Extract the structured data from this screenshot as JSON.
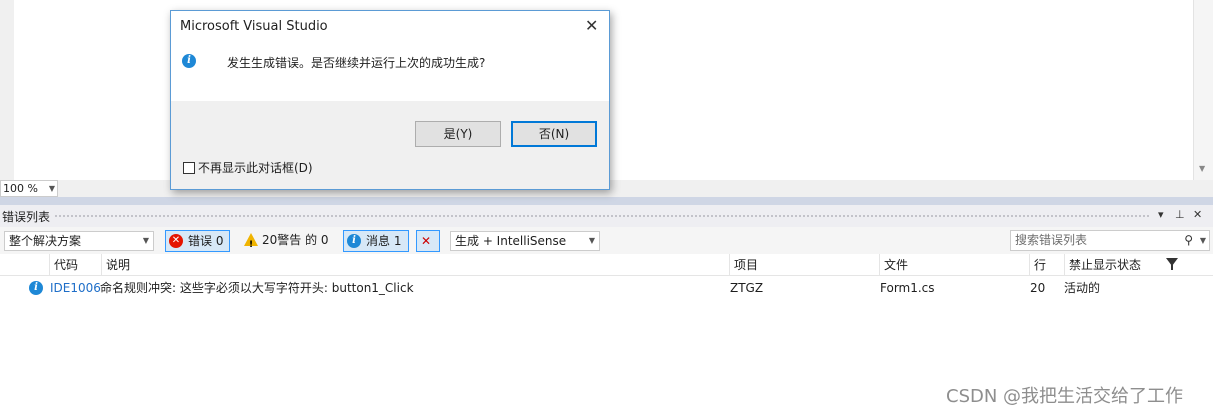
{
  "dialog": {
    "title": "Microsoft Visual Studio",
    "close_glyph": "✕",
    "message": "发生生成错误。是否继续并运行上次的成功生成?",
    "yes_label": "是(Y)",
    "no_label": "否(N)",
    "dont_show_label": "不再显示此对话框(D)",
    "dont_show_checked": false
  },
  "zoom": {
    "value": "100 %"
  },
  "error_list": {
    "title": "错误列表",
    "header_controls": {
      "dropdown": "▾",
      "pin": "⊥",
      "close": "✕"
    },
    "toolbar": {
      "scope": "整个解决方案",
      "errors_label": "错误 0",
      "warnings_label": "20警告 的 0",
      "messages_label": "消息 1",
      "source": "生成 + IntelliSense",
      "search_placeholder": "搜索错误列表"
    },
    "columns": {
      "code": "代码",
      "description": "说明",
      "project": "项目",
      "file": "文件",
      "line": "行",
      "suppression": "禁止显示状态"
    },
    "rows": [
      {
        "code": "IDE1006",
        "description": "命名规则冲突: 这些字必须以大写字符开头: button1_Click",
        "project": "ZTGZ",
        "file": "Form1.cs",
        "line": "20",
        "suppression": "活动的"
      }
    ]
  },
  "watermark": "CSDN @我把生活交给了工作",
  "colors": {
    "accent": "#0078d7",
    "error": "#e51400",
    "warning": "#f0b400",
    "info": "#1e88d6",
    "link": "#1e6ec8"
  },
  "icons": [
    "info-icon",
    "error-icon",
    "warning-icon",
    "filter-icon",
    "search-icon",
    "close-icon",
    "pin-icon"
  ]
}
